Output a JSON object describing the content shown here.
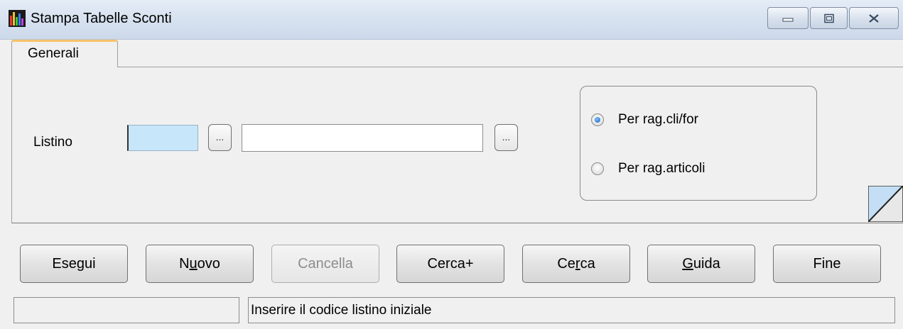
{
  "window": {
    "title": "Stampa Tabelle Sconti",
    "icon": "chart-bars-icon",
    "controls": [
      "minimize-icon",
      "maximize-icon",
      "close-icon"
    ]
  },
  "tabs": [
    {
      "label": "Generali",
      "active": true
    }
  ],
  "form": {
    "listino_label": "Listino",
    "listino_code_value": "",
    "listino_desc_value": "",
    "browse_label": "..."
  },
  "options": {
    "items": [
      {
        "label": "Per rag.cli/for",
        "selected": true
      },
      {
        "label": "Per rag.articoli",
        "selected": false
      }
    ]
  },
  "buttons": [
    {
      "label": "Esegui",
      "enabled": true
    },
    {
      "label_pre": "N",
      "label_ul": "u",
      "label_post": "ovo",
      "enabled": true
    },
    {
      "label": "Cancella",
      "enabled": false
    },
    {
      "label": "Cerca+",
      "enabled": true
    },
    {
      "label_pre": "Ce",
      "label_ul": "r",
      "label_post": "ca",
      "enabled": true
    },
    {
      "label_pre": "",
      "label_ul": "G",
      "label_post": "uida",
      "enabled": true
    },
    {
      "label": "Fine",
      "enabled": true
    }
  ],
  "status": {
    "left": "",
    "message": "Inserire il codice listino iniziale"
  },
  "colors": {
    "code_input_bg": "#c8e6fa",
    "tab_accent": "#f7c26b"
  }
}
